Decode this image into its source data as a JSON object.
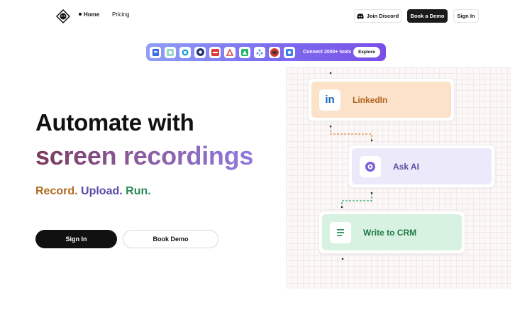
{
  "nav": {
    "home_label": "Home",
    "pricing_label": "Pricing",
    "discord_label": "Join Discord",
    "demo_label": "Book a Demo",
    "signin_label": "Sign In"
  },
  "toolbar": {
    "icons": [
      "google-docs-icon",
      "tool-2-icon",
      "tool-3-icon",
      "tool-4-icon",
      "tool-5-icon",
      "tool-6-icon",
      "tool-7-icon",
      "tool-8-icon",
      "tool-9-icon",
      "tool-10-icon"
    ],
    "text": "Connect 2000+ tools",
    "explore_label": "Explore"
  },
  "hero": {
    "line1": "Automate with",
    "line2": "screen recordings",
    "tag_record": "Record.",
    "tag_upload": "Upload.",
    "tag_run": "Run.",
    "signin_label": "Sign In",
    "demo_label": "Book Demo"
  },
  "flow": {
    "step1": "LinkedIn",
    "step1_icon_text": "in",
    "step2": "Ask AI",
    "step3": "Write to CRM"
  },
  "colors": {
    "accent_dark": "#111111",
    "tag_record": "#b06a1f",
    "tag_upload": "#5a4aa8",
    "tag_run": "#2a8a55"
  }
}
